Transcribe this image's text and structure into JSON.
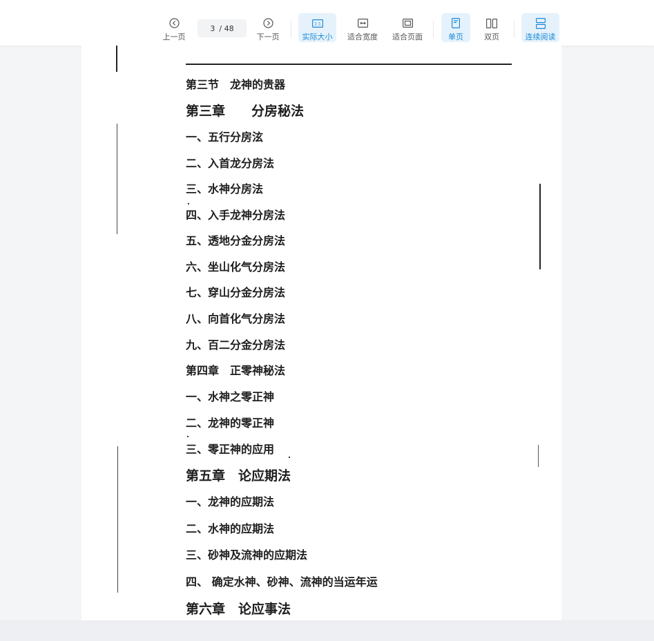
{
  "toolbar": {
    "prev_label": "上一页",
    "next_label": "下一页",
    "current_page": "3",
    "total_pages": "/ 48",
    "actual_size_label": "实际大小",
    "fit_width_label": "适合宽度",
    "fit_page_label": "适合页面",
    "single_page_label": "单页",
    "double_page_label": "双页",
    "continuous_label": "连续阅读",
    "accent_color": "#1a8ad8"
  },
  "toc": {
    "items": [
      {
        "text": "第三节　龙神的贵器",
        "kind": "sec"
      },
      {
        "text": "第三章　　分房秘法",
        "kind": "chap"
      },
      {
        "text": "一、五行分房泫",
        "kind": "sub"
      },
      {
        "text": "二、入首龙分房法",
        "kind": "sub"
      },
      {
        "text": "三、水神分房法",
        "kind": "sub"
      },
      {
        "text": "四、入手龙神分房法",
        "kind": "sub"
      },
      {
        "text": "五、透地分金分房法",
        "kind": "sub"
      },
      {
        "text": "六、坐山化气分房法",
        "kind": "sub"
      },
      {
        "text": "七、穿山分金分房法",
        "kind": "sub"
      },
      {
        "text": "八、向首化气分房法",
        "kind": "sub"
      },
      {
        "text": "九、百二分金分房法",
        "kind": "sub"
      },
      {
        "text": "第四章　正零神秘法",
        "kind": "sec"
      },
      {
        "text": "一、水神之零正神",
        "kind": "sub"
      },
      {
        "text": "二、龙神的零正神",
        "kind": "sub"
      },
      {
        "text": "三、零正神的应用",
        "kind": "sub"
      },
      {
        "text": "第五章　论应期法",
        "kind": "chap"
      },
      {
        "text": "一、龙神的应期法",
        "kind": "sub"
      },
      {
        "text": "二、水神的应期法",
        "kind": "sub"
      },
      {
        "text": "三、砂神及流神的应期法",
        "kind": "sub"
      },
      {
        "text": "四、 确定水神、砂神、流神的当运年运",
        "kind": "sub"
      },
      {
        "text": "第六章　论应事法",
        "kind": "chap"
      }
    ]
  }
}
